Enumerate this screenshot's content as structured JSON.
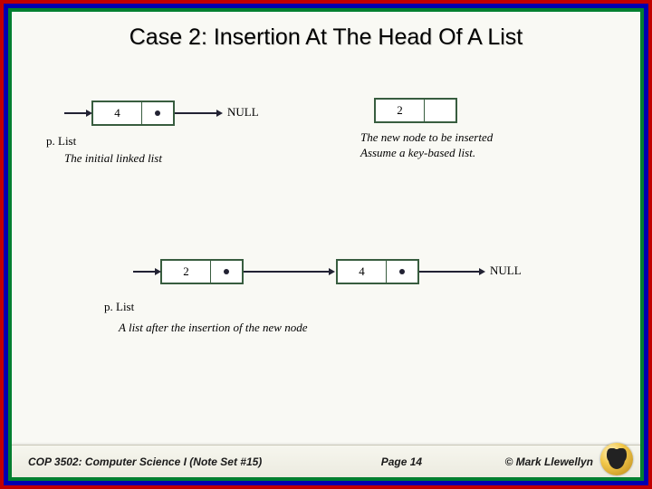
{
  "title": "Case 2: Insertion At The Head Of A List",
  "top": {
    "node1_value": "4",
    "null_label": "NULL",
    "plist_label": "p. List",
    "initial_caption": "The initial linked list",
    "node2_value": "2",
    "new_node_line1": "The new node to be inserted",
    "new_node_line2": "Assume a key-based list."
  },
  "bottom": {
    "nodeA_value": "2",
    "nodeB_value": "4",
    "null_label": "NULL",
    "plist_label": "p. List",
    "after_caption": "A list after the insertion of the new node"
  },
  "footer": {
    "left": "COP 3502: Computer Science I  (Note Set #15)",
    "mid": "Page 14",
    "right": "© Mark Llewellyn"
  }
}
